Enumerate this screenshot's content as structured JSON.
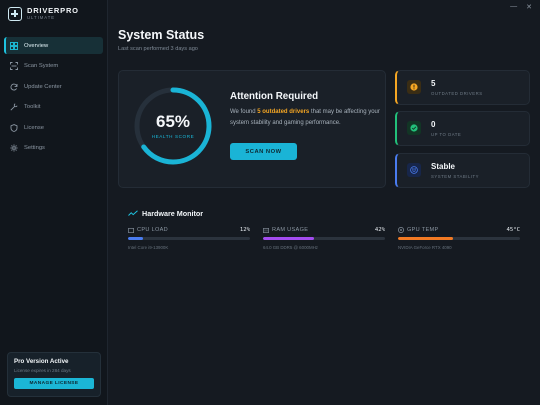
{
  "brand": {
    "name": "DRIVERPRO",
    "sub": "ULTIMATE"
  },
  "window": {
    "minimize": "—",
    "close": "✕"
  },
  "nav": [
    {
      "label": "Overview",
      "icon": "dashboard-icon",
      "active": true
    },
    {
      "label": "Scan System",
      "icon": "scan-icon",
      "active": false
    },
    {
      "label": "Update Center",
      "icon": "refresh-icon",
      "active": false
    },
    {
      "label": "Toolkit",
      "icon": "wrench-icon",
      "active": false
    },
    {
      "label": "License",
      "icon": "shield-icon",
      "active": false
    },
    {
      "label": "Settings",
      "icon": "gear-icon",
      "active": false
    }
  ],
  "pro": {
    "title": "Pro Version Active",
    "sub": "License expires in 284 days",
    "button": "MANAGE LICENSE"
  },
  "header": {
    "title": "System Status",
    "subtitle": "Last scan performed 3 days ago"
  },
  "health": {
    "value": "65%",
    "fraction": 0.65,
    "caption": "HEALTH SCORE",
    "title": "Attention Required",
    "body_pre": "We found",
    "body_highlight": "5 outdated drivers",
    "body_post": "that may be affecting your system stability and gaming performance.",
    "button": "SCAN NOW"
  },
  "stats": [
    {
      "value": "5",
      "label": "OUTDATED DRIVERS",
      "icon": "warning-icon",
      "color": "#f5a623"
    },
    {
      "value": "0",
      "label": "UP TO DATE",
      "icon": "check-icon",
      "color": "#22c07a"
    },
    {
      "value": "Stable",
      "label": "SYSTEM STABILITY",
      "icon": "smile-icon",
      "color": "#4a7cf0"
    }
  ],
  "hardware": {
    "title": "Hardware Monitor",
    "items": [
      {
        "name": "CPU LOAD",
        "value": "12%",
        "sub": "Intel Core i9-13900K",
        "level": 0.12,
        "color": "#4a7cf0",
        "icon": "cpu-icon"
      },
      {
        "name": "RAM USAGE",
        "value": "42%",
        "sub": "64.0 GB DDR5 @ 6000MHz",
        "level": 0.42,
        "color": "#a34cf0",
        "icon": "ram-icon"
      },
      {
        "name": "GPU TEMP",
        "value": "45°C",
        "sub": "NVIDIA GeForce RTX 4090",
        "level": 0.45,
        "color": "#f27a24",
        "icon": "thermometer-icon"
      }
    ]
  },
  "colors": {
    "accent": "#1ab4d6",
    "warning": "#f5a623",
    "success": "#22c07a",
    "info": "#4a7cf0"
  }
}
